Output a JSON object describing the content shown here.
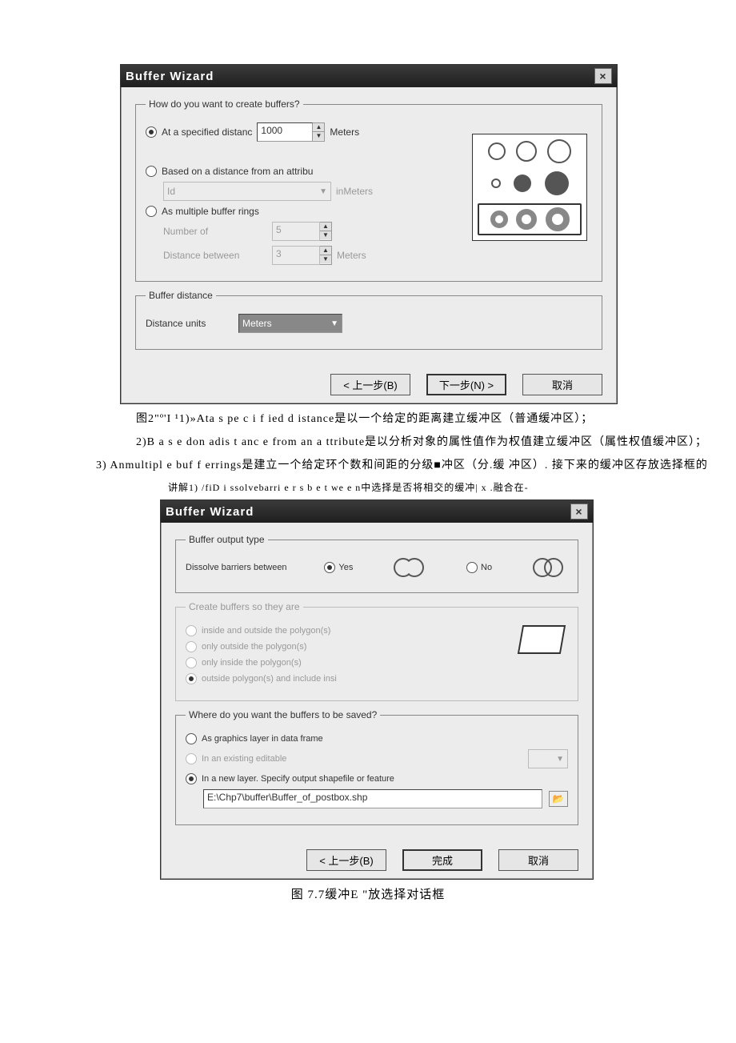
{
  "dialog1": {
    "title": "Buffer Wizard",
    "group_create": {
      "legend": "How do you want to create buffers?",
      "opt_specified": {
        "label": "At a specified distanc",
        "value": "1000",
        "unit": "Meters"
      },
      "opt_attribute": {
        "label": "Based on a distance from an attribu",
        "select_value": "Id",
        "unit": "inMeters"
      },
      "opt_rings": {
        "label": "As multiple buffer rings",
        "num_label": "Number of",
        "num_value": "5",
        "dist_label": "Distance between",
        "dist_value": "3",
        "unit": "Meters"
      }
    },
    "group_distance": {
      "legend": "Buffer distance",
      "units_label": "Distance units",
      "units_value": "Meters"
    },
    "buttons": {
      "back": "< 上一步(B)",
      "next": "下一步(N) >",
      "cancel": "取消"
    }
  },
  "caption1": "图2\"º'I   ¹1)»Ata   s pe c i f ied d istance是以一个给定的距离建立缓冲区（普通缓冲区）；",
  "para2": "2)B a s e don   adis t anc e from   an a ttribute是以分析对象的属性值作为权值建立缓冲区（属性权值缓冲区）；",
  "para3": "3) Anmultipl e buf f errings是建立一个给定环个数和间距的分级■冲区（分.缓  冲区）. 接下来的缓冲区存放选择框的",
  "para3b": "讲解1)   /fiD i ssolvebarri e r s  b e t we e n中选择是否将相交的缓冲| x .融合在-",
  "dialog2": {
    "title": "Buffer Wizard",
    "group_output": {
      "legend": "Buffer output type",
      "dissolve_label": "Dissolve barriers between",
      "yes": "Yes",
      "no": "No"
    },
    "group_create": {
      "legend": "Create buffers so they are",
      "opt1": "inside and outside the polygon(s)",
      "opt2": "only outside the polygon(s)",
      "opt3": "only inside the polygon(s)",
      "opt4": "outside polygon(s) and include insi"
    },
    "group_save": {
      "legend": "Where do you want the buffers to be saved?",
      "opt1": "As graphics layer in data frame",
      "opt2": "In an existing editable",
      "opt3": "In a new layer.  Specify output shapefile or feature",
      "path": "E:\\Chp7\\buffer\\Buffer_of_postbox.shp"
    },
    "buttons": {
      "back": "< 上一步(B)",
      "finish": "完成",
      "cancel": "取消"
    }
  },
  "caption2": "图 7.7缓冲E   \"放选择对话框"
}
